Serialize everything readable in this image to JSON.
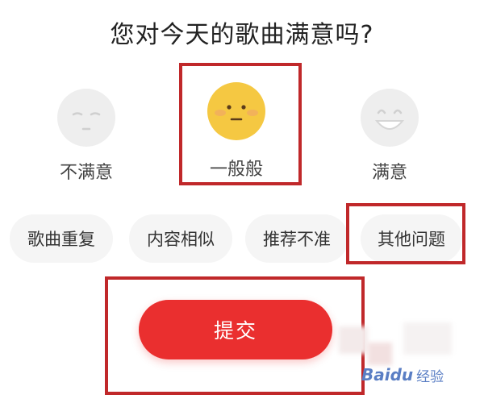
{
  "question": "您对今天的歌曲满意吗?",
  "ratings": [
    {
      "label": "不满意",
      "icon": "unsatisfied-face-icon",
      "selected": false
    },
    {
      "label": "一般般",
      "icon": "neutral-face-icon",
      "selected": true
    },
    {
      "label": "满意",
      "icon": "satisfied-face-icon",
      "selected": false
    }
  ],
  "issues": [
    {
      "label": "歌曲重复"
    },
    {
      "label": "内容相似"
    },
    {
      "label": "推荐不准"
    },
    {
      "label": "其他问题"
    }
  ],
  "submit_label": "提交",
  "watermark": {
    "brand": "Baidu",
    "suffix": "经验"
  },
  "colors": {
    "accent": "#ea2f2f",
    "highlight": "#c0282a",
    "face_yellow": "#f5c842",
    "face_gray": "#eeeeee"
  }
}
